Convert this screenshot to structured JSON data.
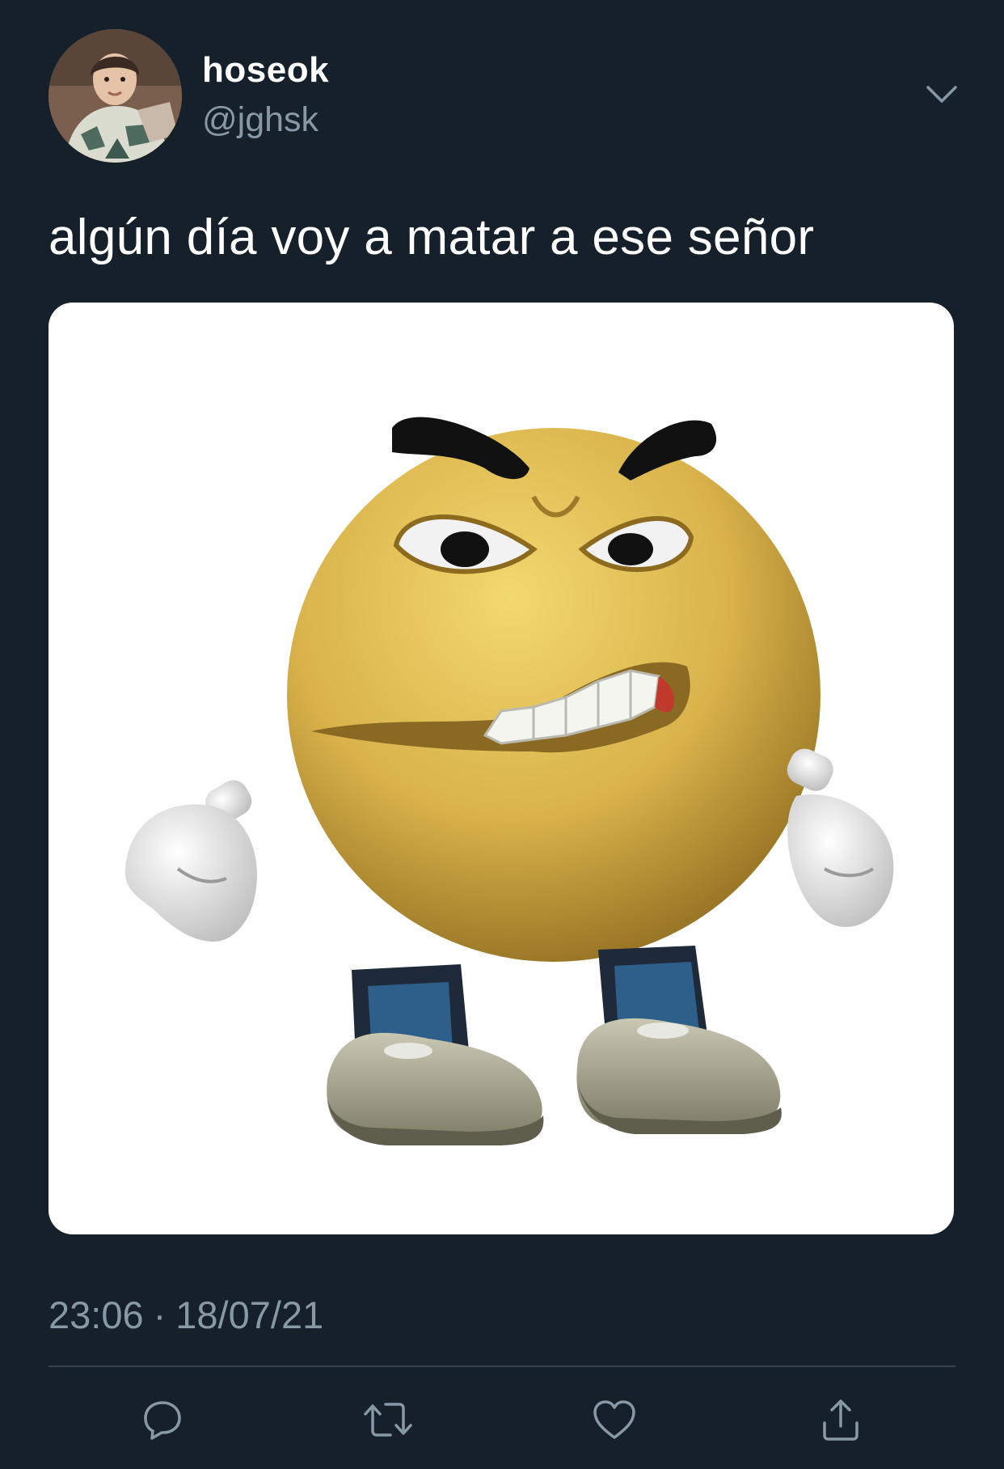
{
  "author": {
    "display_name": "hoseok",
    "handle": "@jghsk",
    "avatar_icon": "profile-photo"
  },
  "tweet": {
    "text": "algún día voy a matar a ese señor",
    "media_description_icon": "angry-emoji-character-image"
  },
  "meta": {
    "time": "23:06",
    "separator": "·",
    "date": "18/07/21"
  },
  "actions": [
    {
      "icon": "reply-icon"
    },
    {
      "icon": "retweet-icon"
    },
    {
      "icon": "like-icon"
    },
    {
      "icon": "share-icon"
    }
  ],
  "colors": {
    "background": "#15202b",
    "secondary_text": "#8899a6",
    "divider": "#38444d",
    "primary_text": "#ffffff"
  }
}
